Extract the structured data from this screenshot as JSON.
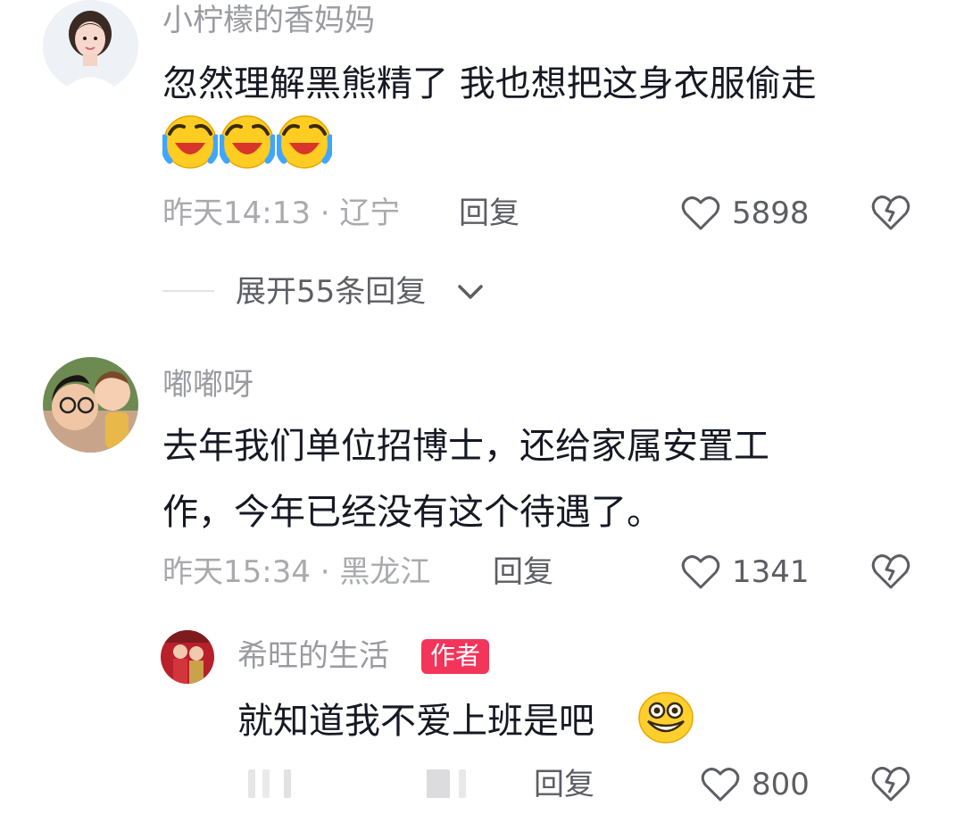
{
  "comments": [
    {
      "username": "小柠檬的香妈妈",
      "text_line1": "忽然理解黑熊精了 我也想把这身衣服偷走",
      "emoji_icons": [
        "laughing-crying-emoji",
        "laughing-crying-emoji",
        "laughing-crying-emoji"
      ],
      "time_location": "昨天14:13 · 辽宁",
      "reply_label": "回复",
      "like_count": "5898",
      "expand_label": "展开55条回复"
    },
    {
      "username": "嘟嘟呀",
      "text_line1": "去年我们单位招博士，还给家属安置工",
      "text_line2": "作，今年已经没有这个待遇了。",
      "time_location": "昨天15:34 · 黑龙江",
      "reply_label": "回复",
      "like_count": "1341"
    }
  ],
  "reply": {
    "username": "希旺的生活",
    "author_badge": "作者",
    "text": "就知道我不爱上班是吧",
    "emoji_icon": "grinning-emoji",
    "reply_label": "回复",
    "like_count": "800"
  },
  "colors": {
    "author_badge": "#f3355a",
    "primary_text": "#161823",
    "secondary_text": "#a9aaae"
  }
}
